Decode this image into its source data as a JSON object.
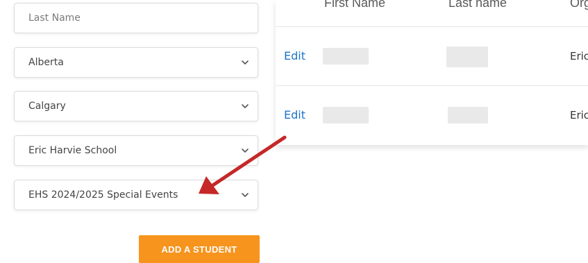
{
  "form": {
    "last_name_placeholder": "Last Name",
    "province": "Alberta",
    "city": "Calgary",
    "school": "Eric Harvie School",
    "program": "EHS 2024/2025 Special Events",
    "add_button": "ADD A STUDENT"
  },
  "table": {
    "headers": [
      "First Name",
      "Last name",
      "Org"
    ],
    "rows": [
      {
        "action": "Edit",
        "org": "Eric"
      },
      {
        "action": "Edit",
        "org": "Eric"
      }
    ]
  },
  "colors": {
    "accent": "#f7941d",
    "link": "#1a73c8",
    "annotation_arrow": "#c62828"
  },
  "icons": {
    "select": "chevron-down-icon",
    "annotation": "red-arrow-annotation"
  }
}
